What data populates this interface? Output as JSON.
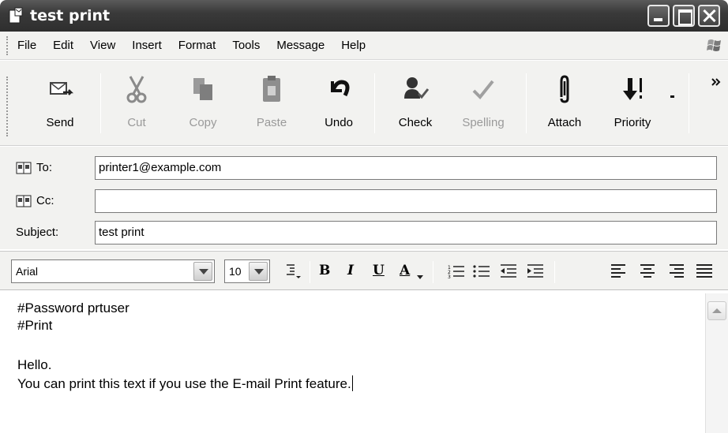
{
  "window": {
    "title": "test print"
  },
  "menu": [
    "File",
    "Edit",
    "View",
    "Insert",
    "Format",
    "Tools",
    "Message",
    "Help"
  ],
  "toolbar": {
    "send": "Send",
    "cut": "Cut",
    "copy": "Copy",
    "paste": "Paste",
    "undo": "Undo",
    "check": "Check",
    "spelling": "Spelling",
    "attach": "Attach",
    "priority": "Priority"
  },
  "headers": {
    "to_label": "To:",
    "to_value": "printer1@example.com",
    "cc_label": "Cc:",
    "cc_value": "",
    "subject_label": "Subject:",
    "subject_value": "test print"
  },
  "format": {
    "font": "Arial",
    "size": "10",
    "bold": "B",
    "italic": "I",
    "underline": "U",
    "color": "A"
  },
  "body": {
    "line1": "#Password prtuser",
    "line2": "#Print",
    "line3": "Hello.",
    "line4": "You can print this text if you use the E-mail Print feature."
  }
}
